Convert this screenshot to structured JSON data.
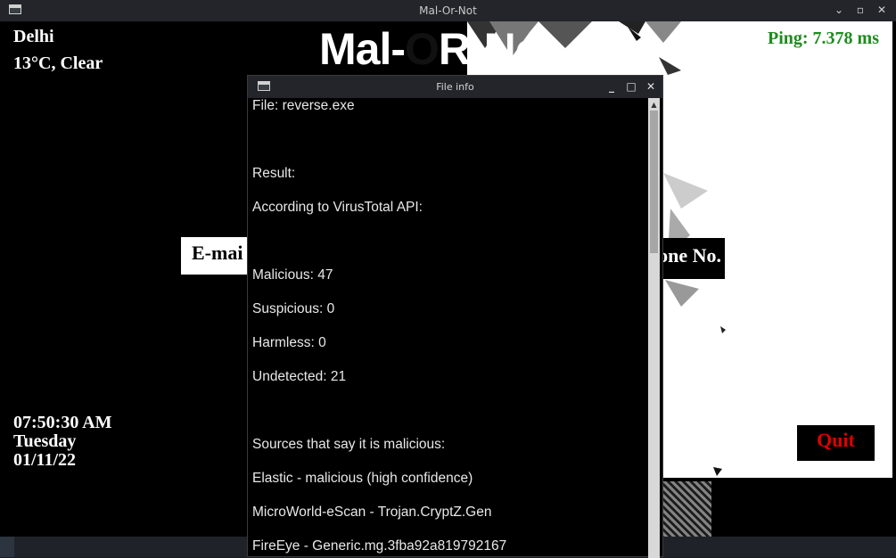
{
  "main_window": {
    "title": "Mal-Or-Not",
    "city": "Delhi",
    "weather": "13°C, Clear",
    "app_title_part1": "Mal-",
    "app_title_part2": "O",
    "app_title_part3": "R-Not",
    "ping": "Ping: 7.378 ms",
    "email_button": "E-mai",
    "phone_button": "one No.",
    "time": "07:50:30 AM",
    "day": "Tuesday",
    "date": "01/11/22",
    "quit_button": "Quit",
    "controls": {
      "minimize": "⌄",
      "maximize": "▫",
      "close": "✕"
    }
  },
  "file_info": {
    "title": "File info",
    "controls": {
      "minimize": "_",
      "maximize": "□",
      "close": "✕"
    },
    "lines": [
      "File: reverse.exe",
      "Result:",
      "According to VirusTotal API:",
      "Malicious: 47",
      "Suspicious: 0",
      "Harmless: 0",
      "Undetected: 21",
      "Sources that say it is malicious:",
      "Elastic -  malicious (high confidence)",
      "MicroWorld-eScan -  Trojan.CryptZ.Gen",
      "FireEye -  Generic.mg.3fba92a819792167"
    ]
  },
  "colors": {
    "ping": "#1e8c1e",
    "quit": "#e10000",
    "titlebar": "#23252a"
  }
}
